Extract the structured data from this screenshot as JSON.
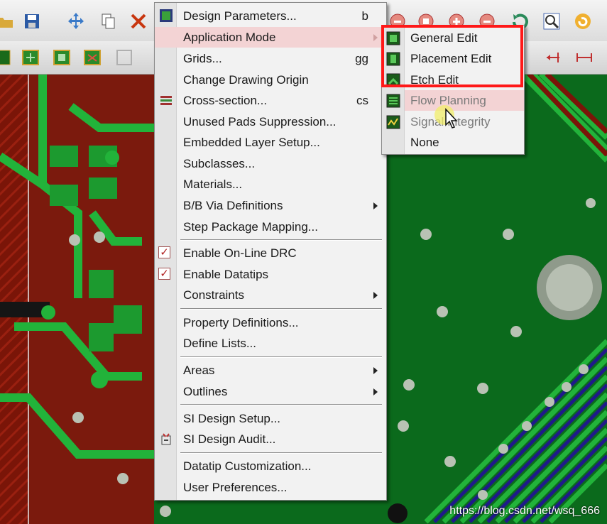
{
  "main_menu": {
    "items": [
      {
        "label": "Design Parameters...",
        "shortcut": "b"
      },
      {
        "label": "Application Mode",
        "submenu": true
      },
      {
        "label": "Grids...",
        "shortcut": "gg"
      },
      {
        "label": "Change Drawing Origin"
      },
      {
        "label": "Cross-section...",
        "shortcut": "cs"
      },
      {
        "label": "Unused Pads Suppression..."
      },
      {
        "label": "Embedded Layer Setup..."
      },
      {
        "label": "Subclasses..."
      },
      {
        "label": "Materials..."
      },
      {
        "label": "B/B Via Definitions",
        "submenu": true
      },
      {
        "label": "Step Package Mapping..."
      },
      {
        "label": "Enable On-Line DRC",
        "checked": true
      },
      {
        "label": "Enable Datatips",
        "checked": true
      },
      {
        "label": "Constraints",
        "submenu": true
      },
      {
        "label": "Property Definitions..."
      },
      {
        "label": "Define Lists..."
      },
      {
        "label": "Areas",
        "submenu": true
      },
      {
        "label": "Outlines",
        "submenu": true
      },
      {
        "label": "SI Design Setup..."
      },
      {
        "label": "SI Design Audit..."
      },
      {
        "label": "Datatip Customization..."
      },
      {
        "label": "User Preferences..."
      }
    ]
  },
  "application_mode_submenu": {
    "items": [
      {
        "label": "General Edit"
      },
      {
        "label": "Placement Edit"
      },
      {
        "label": "Etch Edit"
      },
      {
        "label": "Flow Planning"
      },
      {
        "label": "Signal Integrity"
      },
      {
        "label": "None"
      }
    ]
  },
  "watermark": "https://blog.csdn.net/wsq_666",
  "colors": {
    "board_green": "#0b6a1c",
    "trace_green": "#22b33a",
    "copper_red": "#8a1a10",
    "highlight_box": "#ff1818",
    "menu_highlight": "#f3d3d4"
  }
}
